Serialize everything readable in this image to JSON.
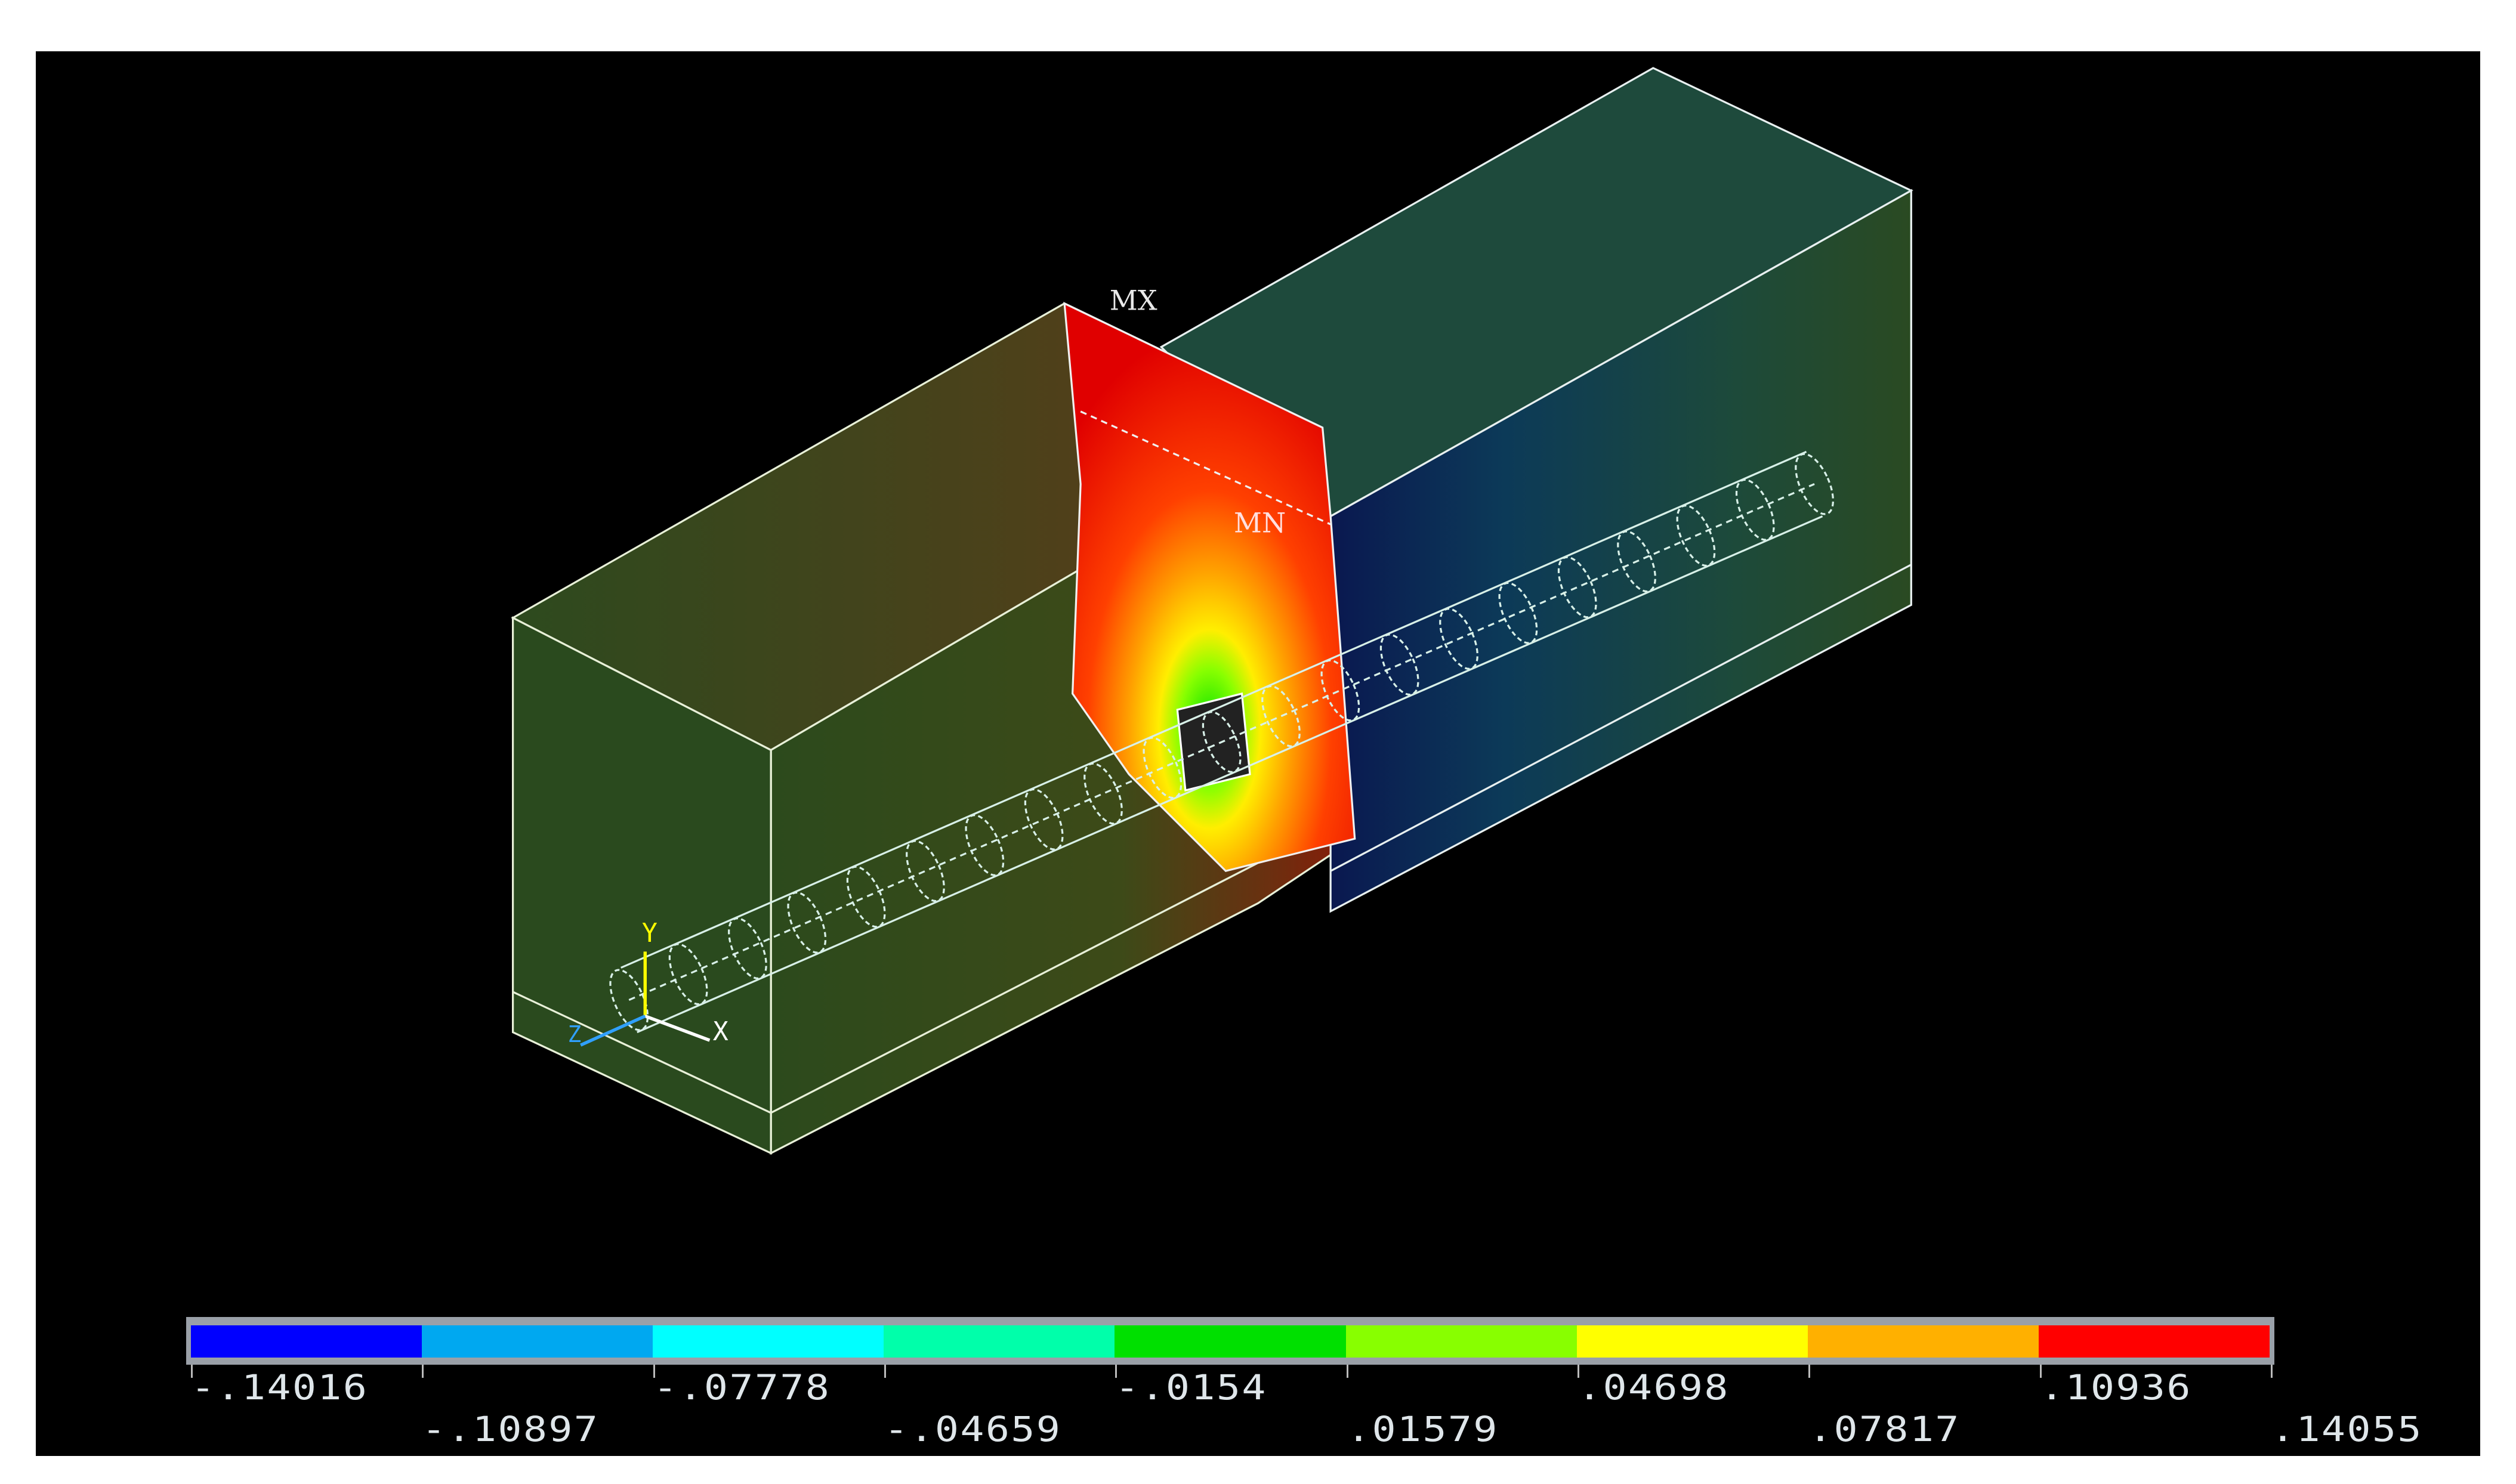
{
  "model": {
    "max_label": "MX",
    "min_label": "MN",
    "axis_labels": {
      "y": "Y",
      "x": "X",
      "z": "Z"
    }
  },
  "legend": {
    "colors": [
      "#0000ff",
      "#00a8f0",
      "#00ffff",
      "#00ffaa",
      "#00e000",
      "#88ff00",
      "#ffff00",
      "#ffb000",
      "#ff0000"
    ],
    "row1": [
      "-.14016",
      "-.07778",
      "-.0154",
      ".04698",
      ".10936"
    ],
    "row2": [
      "-.10897",
      "-.04659",
      ".01579",
      ".07817",
      ".14055"
    ]
  }
}
